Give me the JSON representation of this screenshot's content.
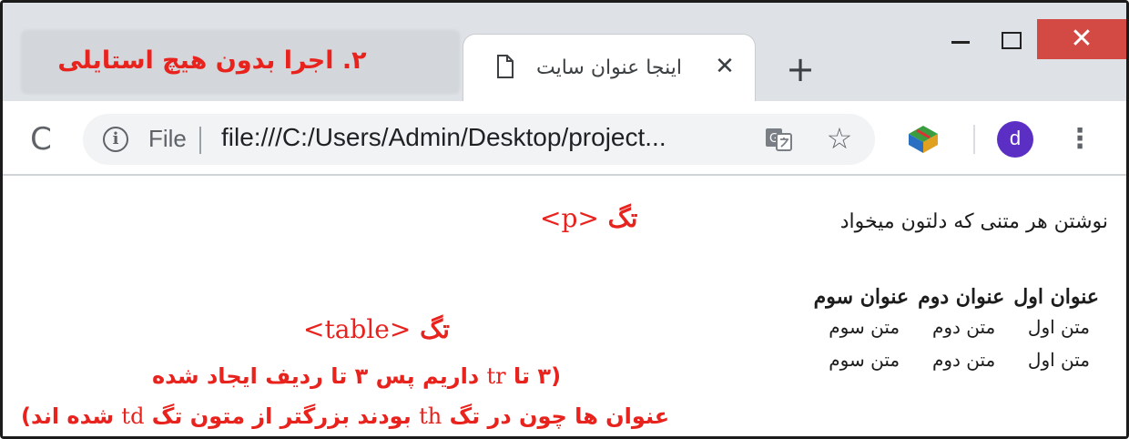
{
  "window": {
    "tab_annotation": "۲. اجرا بدون هیچ استایلی",
    "active_tab_title": "اینجا عنوان سایت",
    "tab_close_glyph": "✕",
    "new_tab_glyph": "+",
    "close_glyph": "✕",
    "accent_close_color": "#d34a45"
  },
  "toolbar": {
    "reload_glyph": "C",
    "info_glyph": "i",
    "file_label": "File",
    "url": "file:///C:/Users/Admin/Desktop/project...",
    "star_glyph": "☆",
    "avatar_letter": "d",
    "menu_glyph": "⋮",
    "icons": [
      "reload-icon",
      "info-icon",
      "translate-icon",
      "star-icon",
      "extension-icon",
      "avatar",
      "menu-icon"
    ]
  },
  "page": {
    "paragraph": "نوشتن هر متنی که دلتون میخواد",
    "table": {
      "headers": [
        "عنوان اول",
        "عنوان دوم",
        "عنوان سوم"
      ],
      "rows": [
        [
          "متن اول",
          "متن دوم",
          "متن سوم"
        ],
        [
          "متن اول",
          "متن دوم",
          "متن سوم"
        ]
      ]
    }
  },
  "annotations": {
    "p_word": "تگ",
    "p_tag": "<p>",
    "table_word": "تگ",
    "table_tag": "<table>",
    "line1_a": "(۳ تا",
    "line1_tag": "tr",
    "line1_b": "داریم پس ۳ تا ردیف ایجاد شده",
    "line2_a": "عنوان ها چون در تگ",
    "line2_tag": "th",
    "line2_b": "بودند بزرگتر از متون تگ",
    "line2_tag2": "td",
    "line2_c": "شده اند)",
    "color": "#e8231e"
  }
}
